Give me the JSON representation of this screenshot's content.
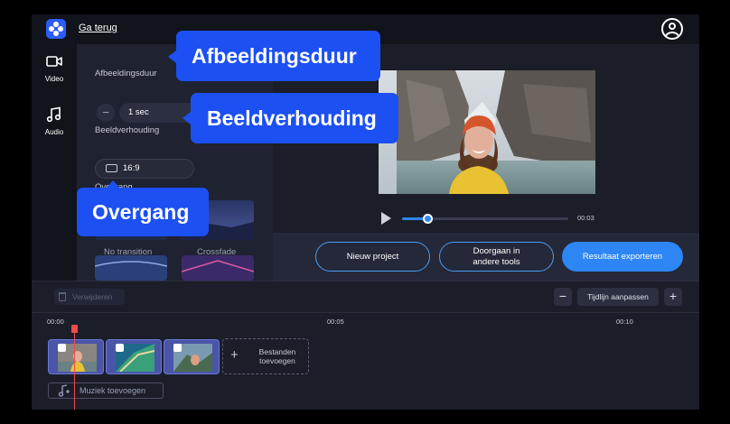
{
  "topbar": {
    "back_label": "Ga terug",
    "logo_icon": "logo-dots-icon",
    "profile_icon": "user-profile-icon"
  },
  "leftnav": {
    "items": [
      {
        "label": "Video",
        "icon": "video-camera-icon"
      },
      {
        "label": "Audio",
        "icon": "music-note-icon"
      }
    ]
  },
  "panel": {
    "duration_label": "Afbeeldingsduur",
    "duration_value": "1 sec",
    "minus": "−",
    "plus": "+",
    "ratio_label": "Beeldverhouding",
    "ratio_value": "16:9",
    "transition_label": "Overgang",
    "transitions": [
      {
        "label": "No transition"
      },
      {
        "label": "Crossfade"
      }
    ]
  },
  "preview": {
    "time": "00:03",
    "progress_fraction": 0.15
  },
  "actions": {
    "new_project": "Nieuw project",
    "continue_line1": "Doorgaan in",
    "continue_line2": "andere tools",
    "export": "Resultaat exporteren"
  },
  "timeline": {
    "delete_label": "Verwijderen",
    "fit_label": "Tijdlijn aanpassen",
    "zoom_out": "−",
    "zoom_in": "+",
    "ticks": [
      "00:00",
      "00:05",
      "00:10"
    ],
    "add_files_line1": "Bestanden",
    "add_files_line2": "toevoegen",
    "add_files_plus": "+",
    "music_label": "Muziek toevoegen"
  },
  "callouts": {
    "duration": "Afbeeldingsduur",
    "ratio": "Beeldverhouding",
    "transition": "Overgang"
  },
  "colors": {
    "accent": "#2e86f5",
    "callout": "#1d50f2",
    "background": "#1b1e29",
    "playhead": "#f04a4a"
  }
}
